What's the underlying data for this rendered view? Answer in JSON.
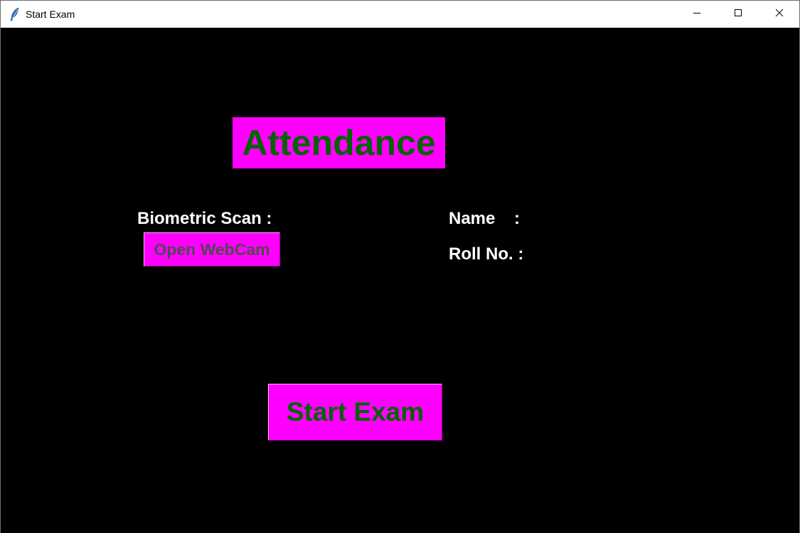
{
  "window": {
    "title": "Start Exam",
    "app_icon": "feather-icon",
    "controls": {
      "minimize_icon": "minimize-icon",
      "maximize_icon": "maximize-icon",
      "close_icon": "close-icon"
    }
  },
  "main": {
    "heading": "Attendance",
    "biometric_label": "Biometric Scan :",
    "webcam_button": "Open WebCam",
    "name_label": "Name    :",
    "roll_label": "Roll No. :",
    "start_button": "Start Exam"
  },
  "colors": {
    "background": "#000000",
    "accent": "#ff00ff",
    "heading_text": "#006400",
    "label_text": "#ffffff",
    "webcam_text": "#4b4b4b"
  }
}
